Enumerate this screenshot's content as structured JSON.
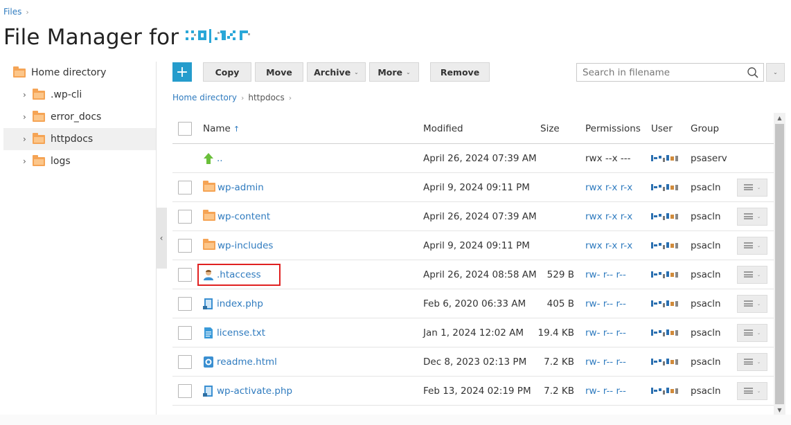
{
  "breadcrumb_top": {
    "label": "Files",
    "sep": "›"
  },
  "title": "File Manager for",
  "logo_alt": "domain logo",
  "sidebar": {
    "root": {
      "label": "Home directory",
      "icon": "folder-icon"
    },
    "items": [
      {
        "label": ".wp-cli",
        "selected": false
      },
      {
        "label": "error_docs",
        "selected": false
      },
      {
        "label": "httpdocs",
        "selected": true
      },
      {
        "label": "logs",
        "selected": false
      }
    ],
    "collapse_icon": "‹"
  },
  "toolbar": {
    "add_label": "+",
    "copy_label": "Copy",
    "move_label": "Move",
    "archive_label": "Archive",
    "more_label": "More",
    "remove_label": "Remove",
    "dropdown_glyph": "⌄"
  },
  "search": {
    "placeholder": "Search in filename",
    "value": ""
  },
  "path": {
    "root": "Home directory",
    "current": "httpdocs",
    "sep": "›"
  },
  "table": {
    "headers": {
      "name": "Name",
      "sort": "↑",
      "modified": "Modified",
      "size": "Size",
      "permissions": "Permissions",
      "user": "User",
      "group": "Group"
    },
    "rows": [
      {
        "name": "..",
        "icon": "up-arrow-icon",
        "modified": "April 26, 2024 07:39 AM",
        "size": "",
        "perm": "rwx --x ---",
        "perm_link": false,
        "group": "psaserv",
        "checkbox": false,
        "actions": false
      },
      {
        "name": "wp-admin",
        "icon": "folder-icon",
        "modified": "April 9, 2024 09:11 PM",
        "size": "",
        "perm": "rwx r-x r-x",
        "perm_link": true,
        "group": "psacln",
        "checkbox": true,
        "actions": true
      },
      {
        "name": "wp-content",
        "icon": "folder-icon",
        "modified": "April 26, 2024 07:39 AM",
        "size": "",
        "perm": "rwx r-x r-x",
        "perm_link": true,
        "group": "psacln",
        "checkbox": true,
        "actions": true
      },
      {
        "name": "wp-includes",
        "icon": "folder-icon",
        "modified": "April 9, 2024 09:11 PM",
        "size": "",
        "perm": "rwx r-x r-x",
        "perm_link": true,
        "group": "psacln",
        "checkbox": true,
        "actions": true
      },
      {
        "name": ".htaccess",
        "icon": "user-file-icon",
        "modified": "April 26, 2024 08:58 AM",
        "size": "529 B",
        "perm": "rw- r-- r--",
        "perm_link": true,
        "group": "psacln",
        "checkbox": true,
        "actions": true
      },
      {
        "name": "index.php",
        "icon": "php-file-icon",
        "modified": "Feb 6, 2020 06:33 AM",
        "size": "405 B",
        "perm": "rw- r-- r--",
        "perm_link": true,
        "group": "psacln",
        "checkbox": true,
        "actions": true
      },
      {
        "name": "license.txt",
        "icon": "text-file-icon",
        "modified": "Jan 1, 2024 12:02 AM",
        "size": "19.4 KB",
        "perm": "rw- r-- r--",
        "perm_link": true,
        "group": "psacln",
        "checkbox": true,
        "actions": true
      },
      {
        "name": "readme.html",
        "icon": "html-file-icon",
        "modified": "Dec 8, 2023 02:13 PM",
        "size": "7.2 KB",
        "perm": "rw- r-- r--",
        "perm_link": true,
        "group": "psacln",
        "checkbox": true,
        "actions": true
      },
      {
        "name": "wp-activate.php",
        "icon": "php-file-icon",
        "modified": "Feb 13, 2024 02:19 PM",
        "size": "7.2 KB",
        "perm": "rw- r-- r--",
        "perm_link": true,
        "group": "psacln",
        "checkbox": true,
        "actions": true
      }
    ]
  },
  "colors": {
    "accent": "#259ccc",
    "link": "#2f7bbf",
    "highlight": "#e02020",
    "folder": "#f5a455"
  }
}
